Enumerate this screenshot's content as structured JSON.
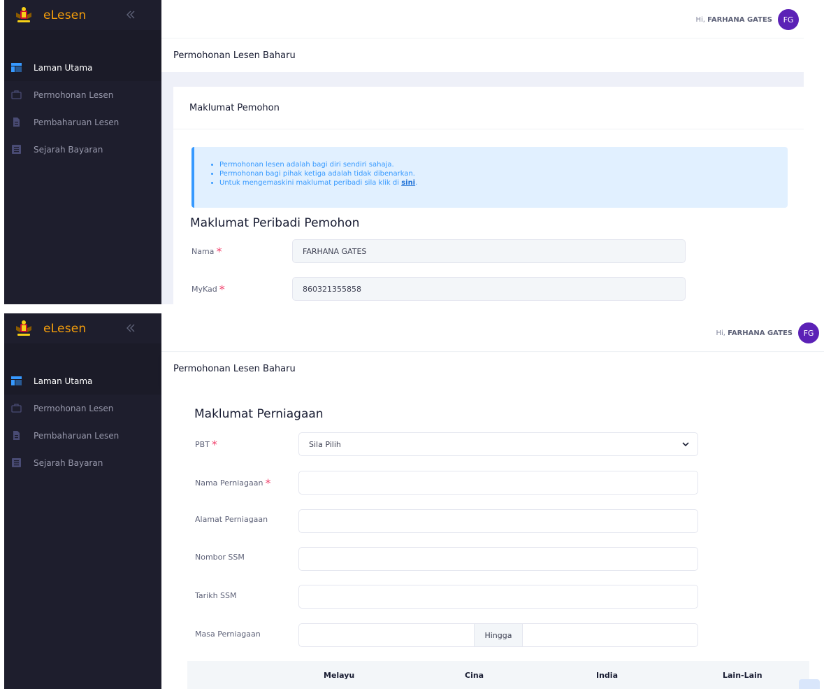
{
  "app": {
    "brand_name": "eLesen"
  },
  "sidebar": {
    "items": [
      {
        "label": "Laman Utama",
        "icon": "layout-icon",
        "active": true
      },
      {
        "label": "Permohonan Lesen",
        "icon": "briefcase-icon",
        "active": false
      },
      {
        "label": "Pembaharuan Lesen",
        "icon": "document-icon",
        "active": false
      },
      {
        "label": "Sejarah Bayaran",
        "icon": "list-icon",
        "active": false
      }
    ]
  },
  "header": {
    "greeting": "Hi,",
    "user_name": "FARHANA GATES",
    "avatar_initials": "FG",
    "page_title": "Permohonan Lesen Baharu"
  },
  "applicant": {
    "card_title": "Maklumat Pemohon",
    "notices": [
      "Permohonan lesen adalah bagi diri sendiri sahaja.",
      "Permohonan bagi pihak ketiga adalah tidak dibenarkan."
    ],
    "update_notice_prefix": "Untuk mengemaskini maklumat peribadi sila klik di",
    "update_notice_link": "sini",
    "update_notice_suffix": ".",
    "section_title": "Maklumat Peribadi Pemohon",
    "fields": {
      "nama_label": "Nama",
      "nama_value": "FARHANA GATES",
      "mykad_label": "MyKad",
      "mykad_value": "860321355858"
    }
  },
  "business": {
    "section_title": "Maklumat Perniagaan",
    "pbt_label": "PBT",
    "pbt_selected": "Sila Pilih",
    "nama_perniagaan_label": "Nama Perniagaan",
    "alamat_label": "Alamat Perniagaan",
    "ssm_number_label": "Nombor SSM",
    "ssm_date_label": "Tarikh SSM",
    "masa_label": "Masa Perniagaan",
    "masa_separator": "Hingga",
    "table_headers": [
      "Melayu",
      "Cina",
      "India",
      "Lain-Lain"
    ]
  },
  "required_marker": "*",
  "colors": {
    "sidebar_bg": "#1e1e2d",
    "brand_text": "#f59e0b",
    "avatar_bg": "#5b21b6",
    "notice_bg": "#e1f0ff",
    "notice_text": "#3699ff",
    "required": "#f1416c"
  }
}
